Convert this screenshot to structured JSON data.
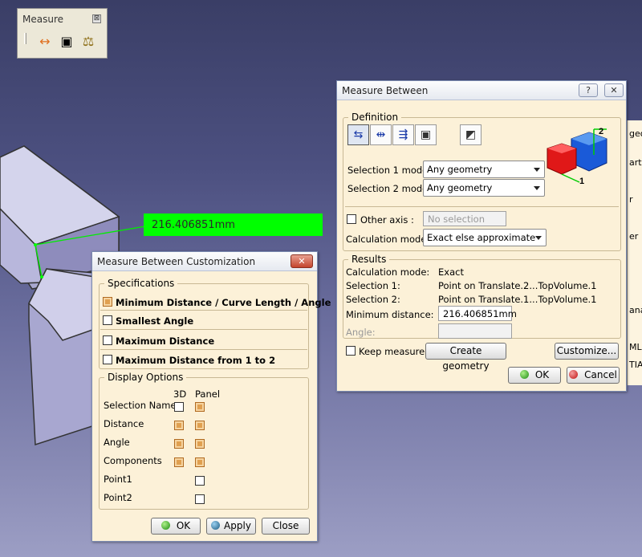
{
  "toolbar": {
    "title": "Measure",
    "close": "⊠"
  },
  "measurement_label": "216.406851mm",
  "measure_between": {
    "title": "Measure Between",
    "help": "?",
    "close": "✕",
    "definition_legend": "Definition",
    "selection1_label": "Selection 1 mode:",
    "selection1_value": "Any geometry",
    "selection2_label": "Selection 2 mode:",
    "selection2_value": "Any geometry",
    "other_axis_label": "Other axis :",
    "other_axis_value": "No selection",
    "calc_mode_label": "Calculation mode:",
    "calc_mode_value": "Exact else approximate",
    "results_legend": "Results",
    "results": {
      "calc_mode_label": "Calculation mode:",
      "calc_mode_value": "Exact",
      "sel1_label": "Selection 1:",
      "sel1_value": "Point on Translate.2...TopVolume.1",
      "sel2_label": "Selection 2:",
      "sel2_value": "Point on Translate.1...TopVolume.1",
      "min_dist_label": "Minimum distance:",
      "min_dist_value": "216.406851mm",
      "angle_label": "Angle:",
      "angle_value": ""
    },
    "keep_measure_label": "Keep measure",
    "create_geometry_label": "Create geometry",
    "customize_label": "Customize...",
    "ok_label": "OK",
    "cancel_label": "Cancel",
    "cube_labels": [
      "2",
      "1"
    ]
  },
  "customization": {
    "title": "Measure Between Customization",
    "close": "✕",
    "specifications_legend": "Specifications",
    "specs": [
      {
        "label": "Minimum Distance / Curve Length / Angle",
        "checked": true
      },
      {
        "label": "Smallest Angle",
        "checked": false
      },
      {
        "label": "Maximum Distance",
        "checked": false
      },
      {
        "label": "Maximum Distance from 1 to 2",
        "checked": false
      }
    ],
    "display_legend": "Display Options",
    "col_3d": "3D",
    "col_panel": "Panel",
    "options": [
      {
        "label": "Selection Name",
        "d3": false,
        "panel": true
      },
      {
        "label": "Distance",
        "d3": true,
        "panel": true
      },
      {
        "label": "Angle",
        "d3": true,
        "panel": true
      },
      {
        "label": "Components",
        "d3": true,
        "panel": true
      },
      {
        "label": "Point1",
        "d3": null,
        "panel": false
      },
      {
        "label": "Point2",
        "d3": null,
        "panel": false
      }
    ],
    "ok_label": "OK",
    "apply_label": "Apply",
    "close_label": "Close"
  },
  "background_panel_fragments": [
    "geo",
    "art",
    "r",
    "er",
    "ana",
    "ML",
    "TIA"
  ]
}
